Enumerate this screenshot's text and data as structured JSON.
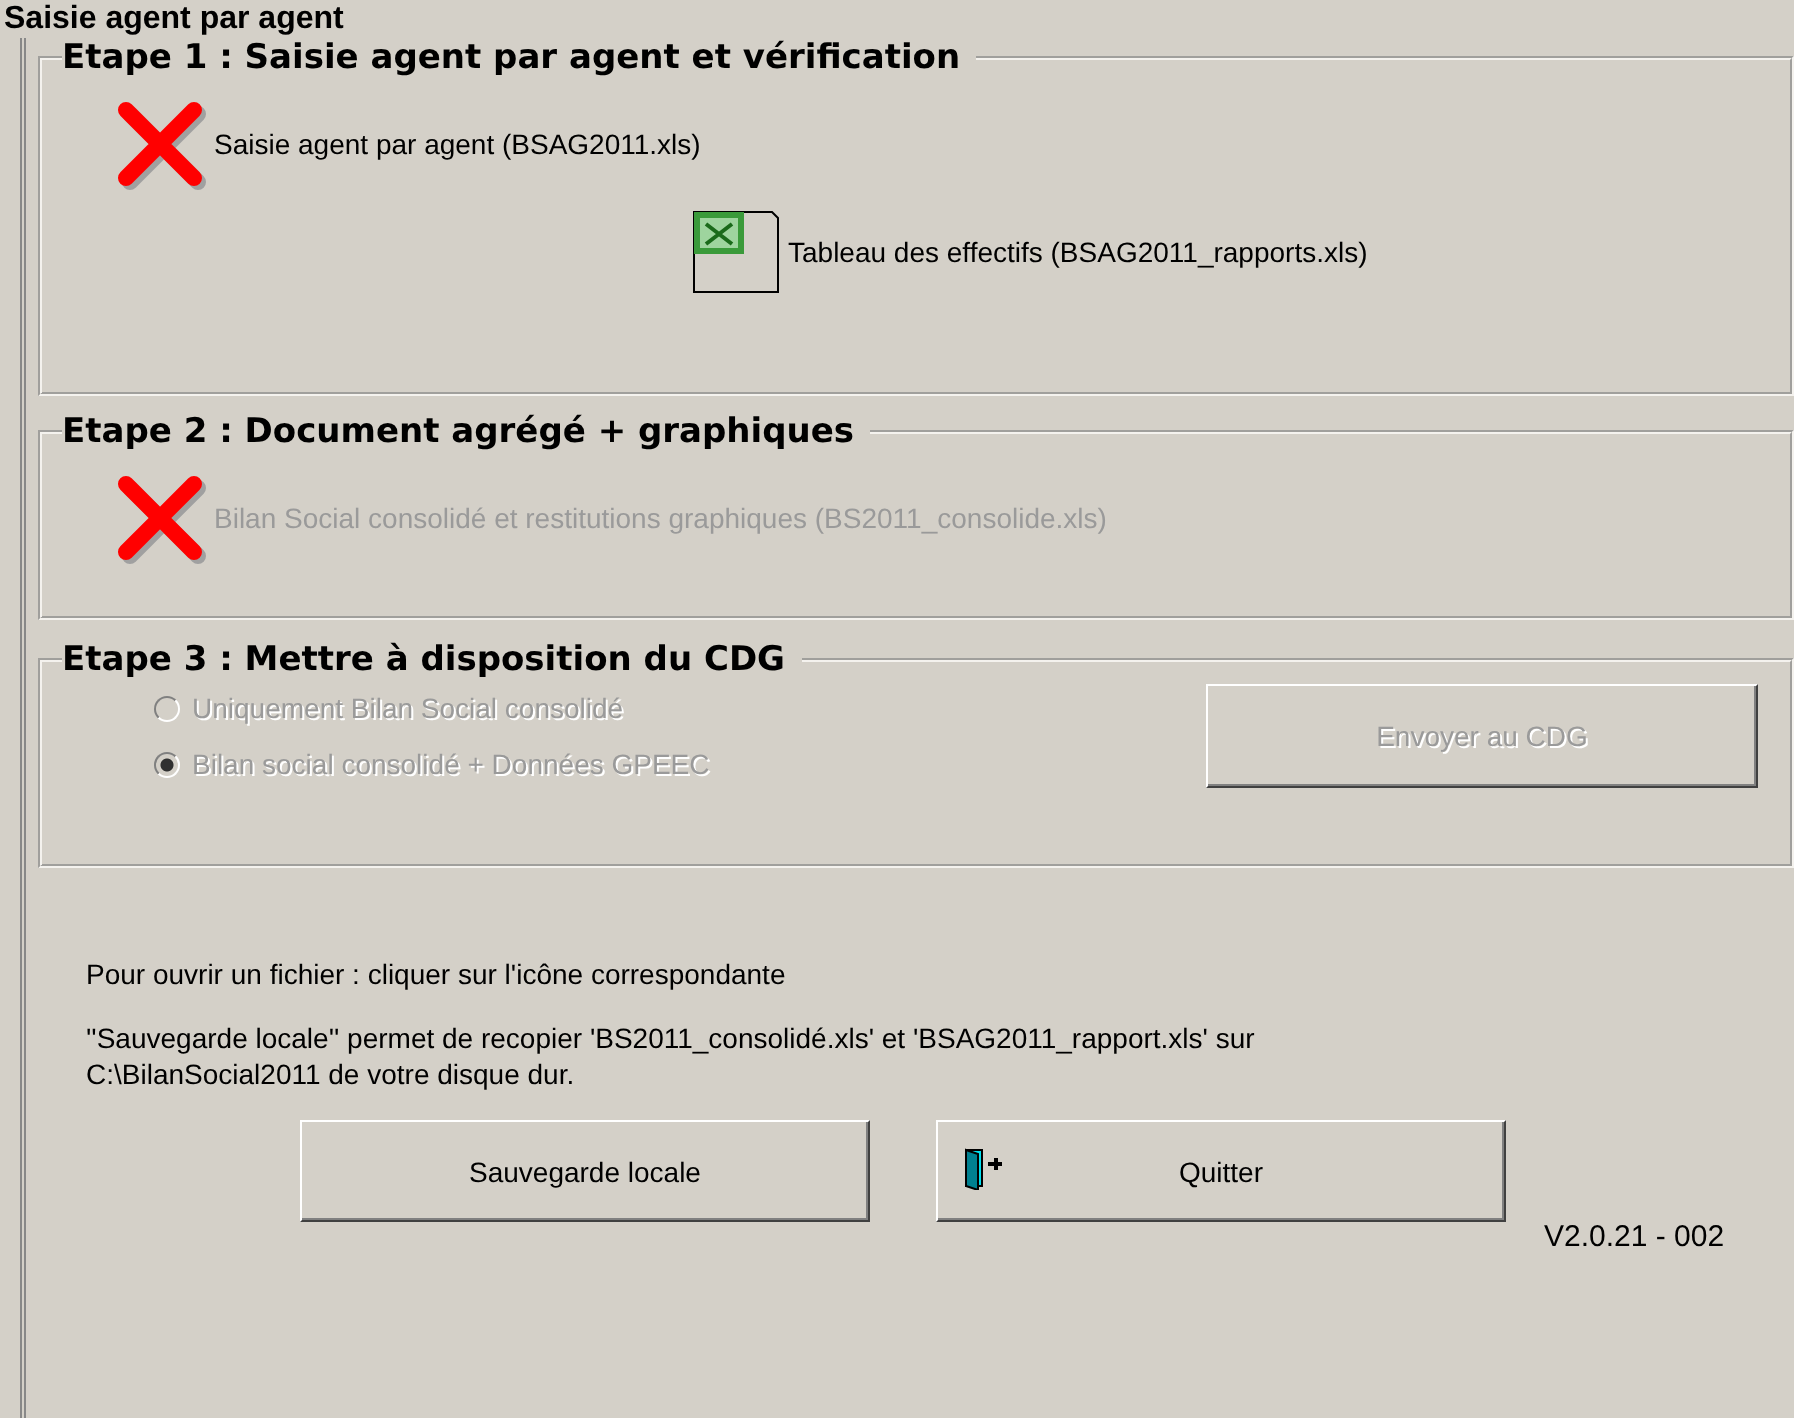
{
  "header": {
    "title": "Saisie agent par agent"
  },
  "steps": [
    {
      "title": "Etape 1 : Saisie agent par agent et vérification",
      "files": [
        {
          "kind": "status",
          "label": "Saisie agent par agent (BSAG2011.xls)",
          "disabled": false
        },
        {
          "kind": "file",
          "label": "Tableau des effectifs (BSAG2011_rapports.xls)",
          "disabled": false
        }
      ]
    },
    {
      "title": "Etape 2 : Document agrégé + graphiques",
      "files": [
        {
          "kind": "status",
          "label": "Bilan Social consolidé et restitutions graphiques (BS2011_consolide.xls)",
          "disabled": true
        }
      ]
    },
    {
      "title": "Etape 3 : Mettre à disposition du CDG",
      "options": [
        {
          "label": "Uniquement Bilan Social consolidé",
          "selected": false,
          "disabled": true
        },
        {
          "label": "Bilan social consolidé + Données GPEEC",
          "selected": true,
          "disabled": true
        }
      ],
      "button": {
        "label": "Envoyer au CDG",
        "disabled": true
      }
    }
  ],
  "notes": [
    "Pour ouvrir un fichier : cliquer sur l'icône correspondante",
    "''Sauvegarde locale'' permet de recopier 'BS2011_consolidé.xls' et 'BSAG2011_rapport.xls' sur C:\\BilanSocial2011 de votre disque dur."
  ],
  "buttons": [
    {
      "kind": "plain",
      "label": "Sauvegarde locale"
    },
    {
      "kind": "exit",
      "label": "Quitter"
    }
  ],
  "version": "V2.0.21 - 002"
}
